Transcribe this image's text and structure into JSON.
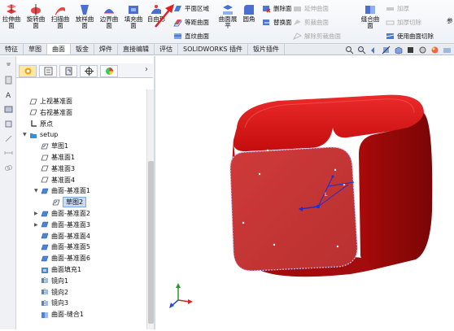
{
  "ribbon": {
    "big_buttons": [
      {
        "label": "拉伸曲面",
        "icon": "extrude-surface-icon"
      },
      {
        "label": "旋转曲面",
        "icon": "revolve-surface-icon"
      },
      {
        "label": "扫描曲面",
        "icon": "sweep-surface-icon"
      },
      {
        "label": "放样曲面",
        "icon": "loft-surface-icon"
      },
      {
        "label": "边界曲面",
        "icon": "boundary-surface-icon"
      },
      {
        "label": "填充曲面",
        "icon": "fill-surface-icon"
      },
      {
        "label": "自由形",
        "icon": "freeform-icon"
      }
    ],
    "col1": [
      {
        "label": "平面区域",
        "icon": "planar-surface-icon"
      },
      {
        "label": "等距曲面",
        "icon": "offset-surface-icon"
      },
      {
        "label": "直纹曲面",
        "icon": "ruled-surface-icon"
      }
    ],
    "mid_buttons": [
      {
        "label": "曲面展平",
        "icon": "flatten-surface-icon"
      },
      {
        "label": "圆角",
        "icon": "fillet-icon"
      }
    ],
    "col2": [
      {
        "label": "删除面",
        "icon": "delete-face-icon"
      },
      {
        "label": "替换面",
        "icon": "replace-face-icon"
      }
    ],
    "col3": [
      {
        "label": "延伸曲面",
        "icon": "extend-surface-icon"
      },
      {
        "label": "剪裁曲面",
        "icon": "trim-surface-icon"
      },
      {
        "label": "解除剪裁曲面",
        "icon": "untrim-surface-icon"
      }
    ],
    "knit_button": {
      "label": "缝合曲面",
      "icon": "knit-surface-icon"
    },
    "col4": [
      {
        "label": "加厚",
        "icon": "thicken-icon"
      },
      {
        "label": "加厚切除",
        "icon": "thicken-cut-icon"
      },
      {
        "label": "使用曲面切除",
        "icon": "surface-cut-icon"
      }
    ],
    "right_cut": "参"
  },
  "tabs": [
    "特征",
    "草图",
    "曲面",
    "钣金",
    "焊件",
    "直接编辑",
    "评估",
    "SOLIDWORKS 插件",
    "钣片插件"
  ],
  "active_tab": "曲面",
  "tree": {
    "items": [
      {
        "label": "上视基准面",
        "icon": "plane-icon",
        "indent": 0
      },
      {
        "label": "右视基准面",
        "icon": "plane-icon",
        "indent": 0
      },
      {
        "label": "原点",
        "icon": "origin-icon",
        "indent": 0
      },
      {
        "label": "setup",
        "icon": "folder-icon",
        "indent": 0,
        "expander": "▼"
      },
      {
        "label": "草图1",
        "icon": "sketch-icon",
        "indent": 1
      },
      {
        "label": "基准面1",
        "icon": "plane-icon",
        "indent": 1
      },
      {
        "label": "基准面3",
        "icon": "plane-icon",
        "indent": 1
      },
      {
        "label": "基准面4",
        "icon": "plane-icon",
        "indent": 1
      },
      {
        "label": "曲面-基准面1",
        "icon": "surface-icon",
        "indent": 1,
        "expander": "▼"
      },
      {
        "label": "草图2",
        "icon": "sketch-icon",
        "indent": 2,
        "selected": true
      },
      {
        "label": "曲面-基准面2",
        "icon": "surface-icon",
        "indent": 1,
        "expander": "▶"
      },
      {
        "label": "曲面-基准面3",
        "icon": "surface-icon",
        "indent": 1,
        "expander": "▶"
      },
      {
        "label": "曲面-基准面4",
        "icon": "surface-icon",
        "indent": 1
      },
      {
        "label": "曲面-基准面5",
        "icon": "surface-icon",
        "indent": 1
      },
      {
        "label": "曲面-基准面6",
        "icon": "surface-icon",
        "indent": 1
      },
      {
        "label": "曲面填充1",
        "icon": "fill-surface-icon",
        "indent": 1
      },
      {
        "label": "镜向1",
        "icon": "mirror-icon",
        "indent": 1
      },
      {
        "label": "镜向2",
        "icon": "mirror-icon",
        "indent": 1
      },
      {
        "label": "镜向3",
        "icon": "mirror-icon",
        "indent": 1
      },
      {
        "label": "曲面-缝合1",
        "icon": "knit-surface-icon",
        "indent": 1
      }
    ]
  },
  "colors": {
    "accent": "#2a63c9",
    "surface_red": "#d61414",
    "annotation_arrow": "#e02020",
    "selection_blue": "#c8dcf6"
  }
}
